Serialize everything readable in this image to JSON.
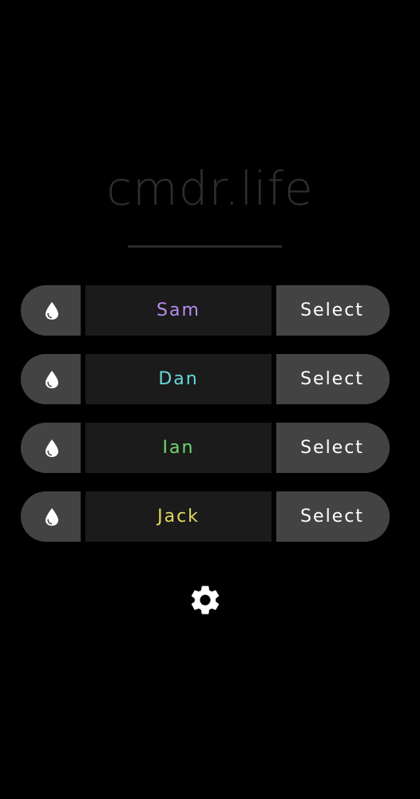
{
  "app": {
    "title": "cmdr.life"
  },
  "players": [
    {
      "name": "Sam",
      "color": "#b88cf0",
      "select_label": "Select",
      "color_icon": "drop-icon"
    },
    {
      "name": "Dan",
      "color": "#66d9dd",
      "select_label": "Select",
      "color_icon": "drop-icon"
    },
    {
      "name": "Ian",
      "color": "#6fd86f",
      "select_label": "Select",
      "color_icon": "drop-icon"
    },
    {
      "name": "Jack",
      "color": "#e3d95f",
      "select_label": "Select",
      "color_icon": "drop-icon"
    }
  ],
  "settings": {
    "icon": "gear-icon"
  },
  "theme": {
    "background": "#000000",
    "button_background": "#434343",
    "name_background": "#1b1b1b",
    "title_color": "#2e2e2e"
  }
}
